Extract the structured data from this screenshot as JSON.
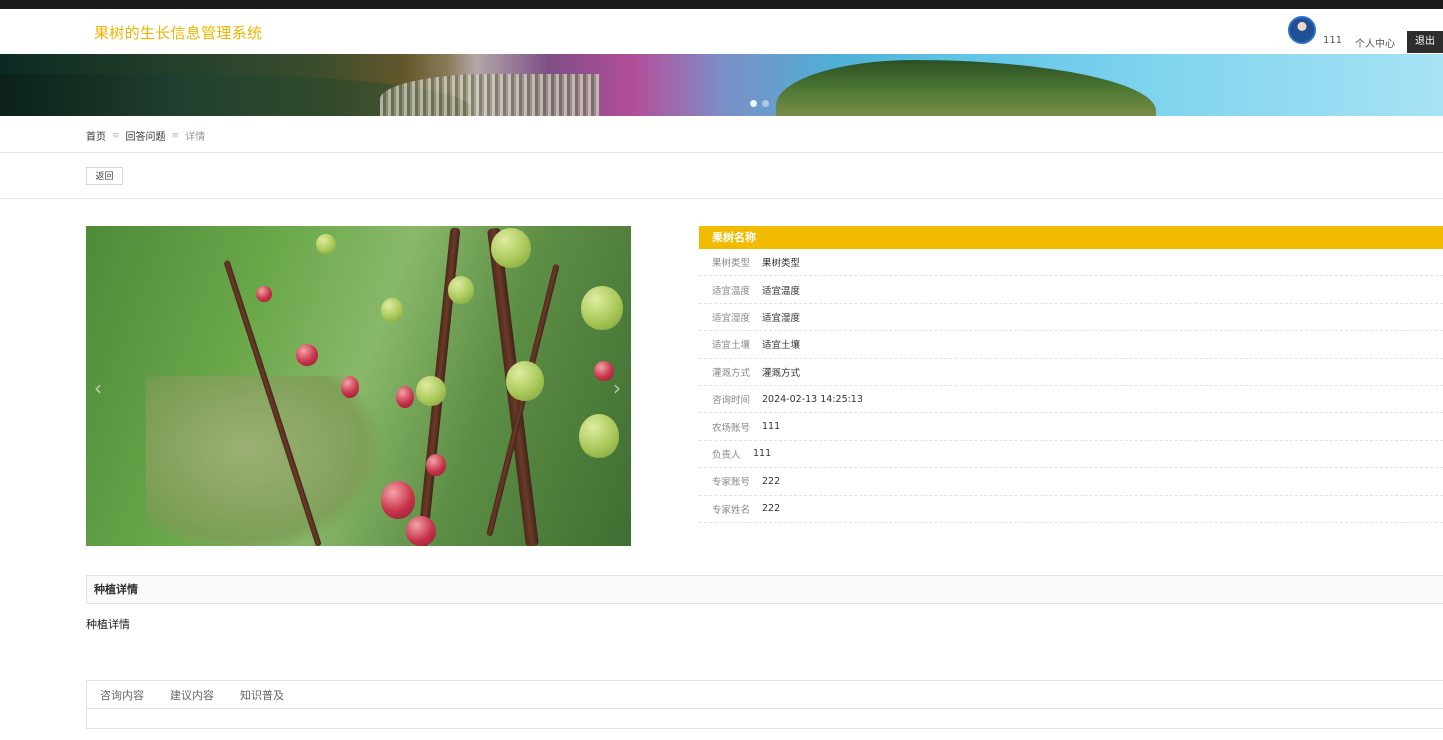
{
  "header": {
    "site_title": "果树的生长信息管理系统",
    "username": "111",
    "profile_label": "个人中心",
    "logout_label": "退出"
  },
  "breadcrumb": {
    "home": "首页",
    "section": "回答问题",
    "current": "详情",
    "separator": "≡"
  },
  "toolbar": {
    "back_label": "返回"
  },
  "info": {
    "title": "果树名称",
    "rows": [
      {
        "label": "果树类型",
        "value": "果树类型"
      },
      {
        "label": "适宜温度",
        "value": "适宜温度"
      },
      {
        "label": "适宜湿度",
        "value": "适宜湿度"
      },
      {
        "label": "适宜土壤",
        "value": "适宜土壤"
      },
      {
        "label": "灌溉方式",
        "value": "灌溉方式"
      },
      {
        "label": "咨询时间",
        "value": "2024-02-13 14:25:13"
      },
      {
        "label": "农场账号",
        "value": "111"
      },
      {
        "label": "负责人",
        "value": "111"
      },
      {
        "label": "专家账号",
        "value": "222"
      },
      {
        "label": "专家姓名",
        "value": "222"
      }
    ]
  },
  "detail": {
    "heading": "种植详情",
    "content": "种植详情"
  },
  "tabs": [
    {
      "label": "咨询内容"
    },
    {
      "label": "建议内容"
    },
    {
      "label": "知识普及"
    }
  ],
  "carousel": {
    "prev_glyph": "‹",
    "next_glyph": "›"
  },
  "colors": {
    "accent": "#f2bb00",
    "title": "#f0b400",
    "logout_bg": "#2d2d2d"
  },
  "icons": [
    "user-avatar",
    "carousel-prev-icon",
    "carousel-next-icon"
  ]
}
